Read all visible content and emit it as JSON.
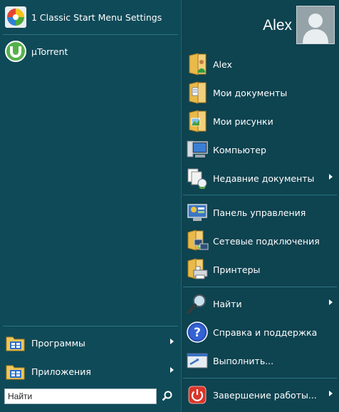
{
  "left": {
    "pinned": [
      {
        "label": "1 Classic Start Menu Settings",
        "icon": "classic-shell-icon"
      },
      {
        "label": "µTorrent",
        "icon": "utorrent-icon"
      }
    ],
    "bottom": [
      {
        "label": "Программы",
        "icon": "programs-folder-icon"
      },
      {
        "label": "Приложения",
        "icon": "apps-folder-icon"
      }
    ],
    "search": {
      "value": "Найти"
    }
  },
  "right": {
    "user_name": "Alex",
    "items": [
      {
        "label": "Alex",
        "icon": "user-folder-icon"
      },
      {
        "label": "Мои документы",
        "icon": "documents-folder-icon"
      },
      {
        "label": "Мои рисунки",
        "icon": "pictures-folder-icon"
      },
      {
        "label": "Компьютер",
        "icon": "computer-icon"
      },
      {
        "label": "Недавние документы",
        "icon": "recent-documents-icon"
      },
      {
        "label": "Панель управления",
        "icon": "control-panel-icon"
      },
      {
        "label": "Сетевые подключения",
        "icon": "network-connections-icon"
      },
      {
        "label": "Принтеры",
        "icon": "printers-icon"
      },
      {
        "label": "Найти",
        "icon": "search-magnifier-icon"
      },
      {
        "label": "Справка и поддержка",
        "icon": "help-icon"
      },
      {
        "label": "Выполнить...",
        "icon": "run-icon"
      },
      {
        "label": "Завершение работы...",
        "icon": "shutdown-icon"
      }
    ]
  },
  "colors": {
    "background": "#0f4a58",
    "separator": "#2a7585",
    "shutdown": "#d9352a"
  }
}
